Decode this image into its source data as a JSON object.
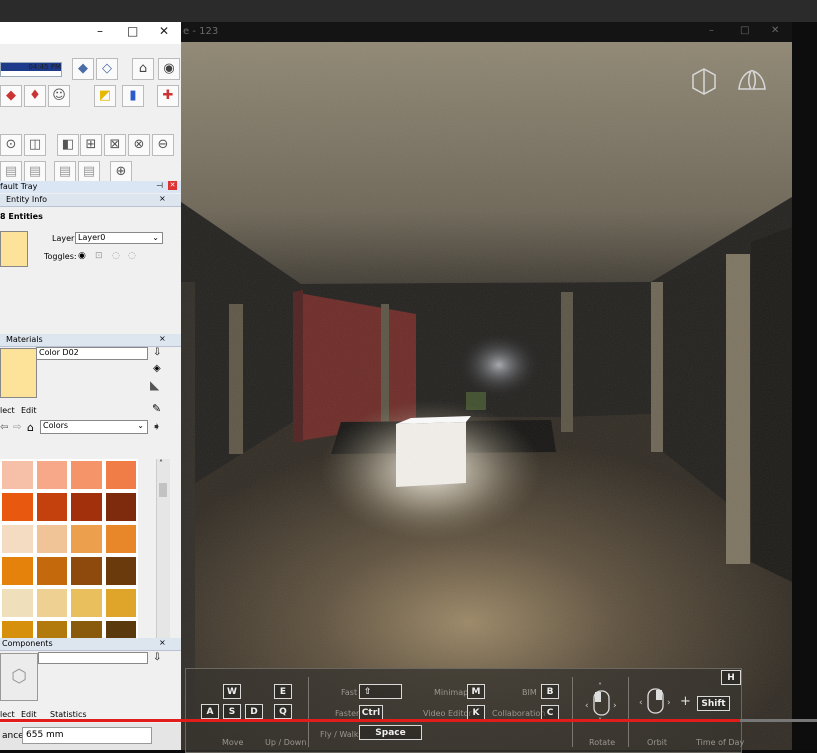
{
  "sketchup": {
    "time_value": "04:45 PM",
    "window_controls": {
      "minimize": "–",
      "maximize": "□",
      "close": "✕"
    },
    "tray_title": "fault Tray",
    "entity_info": {
      "title": "Entity Info",
      "count": "8 Entities",
      "layer_label": "Layer:",
      "layer_value": "Layer0",
      "toggles_label": "Toggles:"
    },
    "materials": {
      "title": "Materials",
      "name": "Color D02",
      "tabs": [
        "lect",
        "Edit"
      ],
      "library": "Colors",
      "swatches": [
        [
          "#f6c0a8",
          "#f6a888",
          "#f49468",
          "#f07d48"
        ],
        [
          "#e8580e",
          "#c4400c",
          "#a3300c",
          "#7e2a0c"
        ],
        [
          "#f3dcc2",
          "#f1c497",
          "#ec9f4c",
          "#e8862a"
        ],
        [
          "#e4820c",
          "#c46a0c",
          "#8e4a0c",
          "#6a3a0c"
        ],
        [
          "#efe0bb",
          "#efd093",
          "#e9be5c",
          "#dfa52a"
        ],
        [
          "#d7900c",
          "#b27a0c",
          "#8a5a0c",
          "#5a3a0c"
        ]
      ]
    },
    "components": {
      "title": "Components",
      "tabs": [
        "lect",
        "Edit",
        "Statistics"
      ]
    },
    "status": {
      "distance_label": "ance",
      "distance_value": "655 mm"
    }
  },
  "viewer": {
    "title": "e - 123",
    "window_controls": {
      "minimize": "–",
      "maximize": "□",
      "close": "✕"
    },
    "help_key": "H",
    "controls": {
      "move_keys": [
        "W",
        "A",
        "S",
        "D"
      ],
      "updown_keys": [
        "E",
        "Q"
      ],
      "move_label": "Move",
      "updown_label": "Up / Down",
      "fast_label": "Fast",
      "fast_key": "⇧",
      "faster_label": "Faster",
      "faster_key": "Ctrl",
      "flywalk_label": "Fly / Walk",
      "flywalk_key": "Space",
      "minimap_label": "Minimap",
      "minimap_key": "M",
      "video_label": "Video Editor",
      "video_key": "K",
      "bim_label": "BIM",
      "bim_key": "B",
      "collab_label": "Collaboration",
      "collab_key": "C",
      "rotate_label": "Rotate",
      "orbit_label": "Orbit",
      "plus": "+",
      "shift_key": "Shift",
      "timeofday_label": "Time of Day"
    }
  },
  "video": {
    "progress_percent": 90.6
  }
}
